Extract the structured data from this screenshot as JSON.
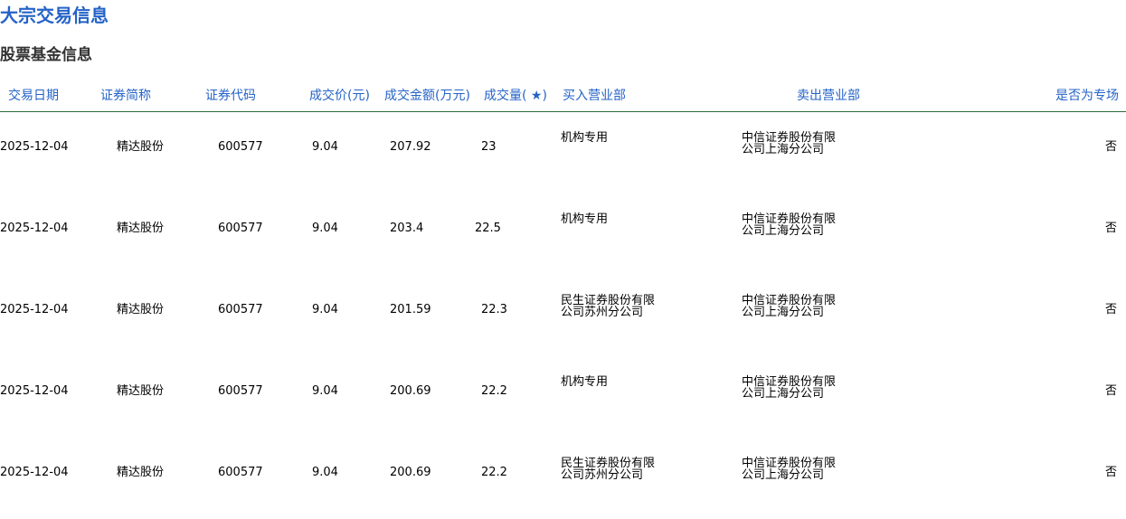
{
  "page": {
    "title": "大宗交易信息",
    "section_title": "股票基金信息"
  },
  "table": {
    "headers": [
      "交易日期",
      "证券简称",
      "证券代码",
      "成交价(元)",
      "成交金额(万元)",
      "成交量( ★)",
      "买入营业部",
      "卖出营业部",
      "是否为专场"
    ],
    "rows": [
      {
        "date": "2025-12-04",
        "name": "精达股份",
        "code": "600577",
        "price": "9.04",
        "amount": "207.92",
        "volume": "23",
        "buyer": "机构专用",
        "seller": "中信证券股份有限公司上海分公司",
        "special": "否"
      },
      {
        "date": "2025-12-04",
        "name": "精达股份",
        "code": "600577",
        "price": "9.04",
        "amount": "203.4",
        "volume": "22.5",
        "buyer": "机构专用",
        "seller": "中信证券股份有限公司上海分公司",
        "special": "否"
      },
      {
        "date": "2025-12-04",
        "name": "精达股份",
        "code": "600577",
        "price": "9.04",
        "amount": "201.59",
        "volume": "22.3",
        "buyer": "民生证券股份有限公司苏州分公司",
        "seller": "中信证券股份有限公司上海分公司",
        "special": "否"
      },
      {
        "date": "2025-12-04",
        "name": "精达股份",
        "code": "600577",
        "price": "9.04",
        "amount": "200.69",
        "volume": "22.2",
        "buyer": "机构专用",
        "seller": "中信证券股份有限公司上海分公司",
        "special": "否"
      },
      {
        "date": "2025-12-04",
        "name": "精达股份",
        "code": "600577",
        "price": "9.04",
        "amount": "200.69",
        "volume": "22.2",
        "buyer": "民生证券股份有限公司苏州分公司",
        "seller": "中信证券股份有限公司上海分公司",
        "special": "否"
      }
    ]
  }
}
